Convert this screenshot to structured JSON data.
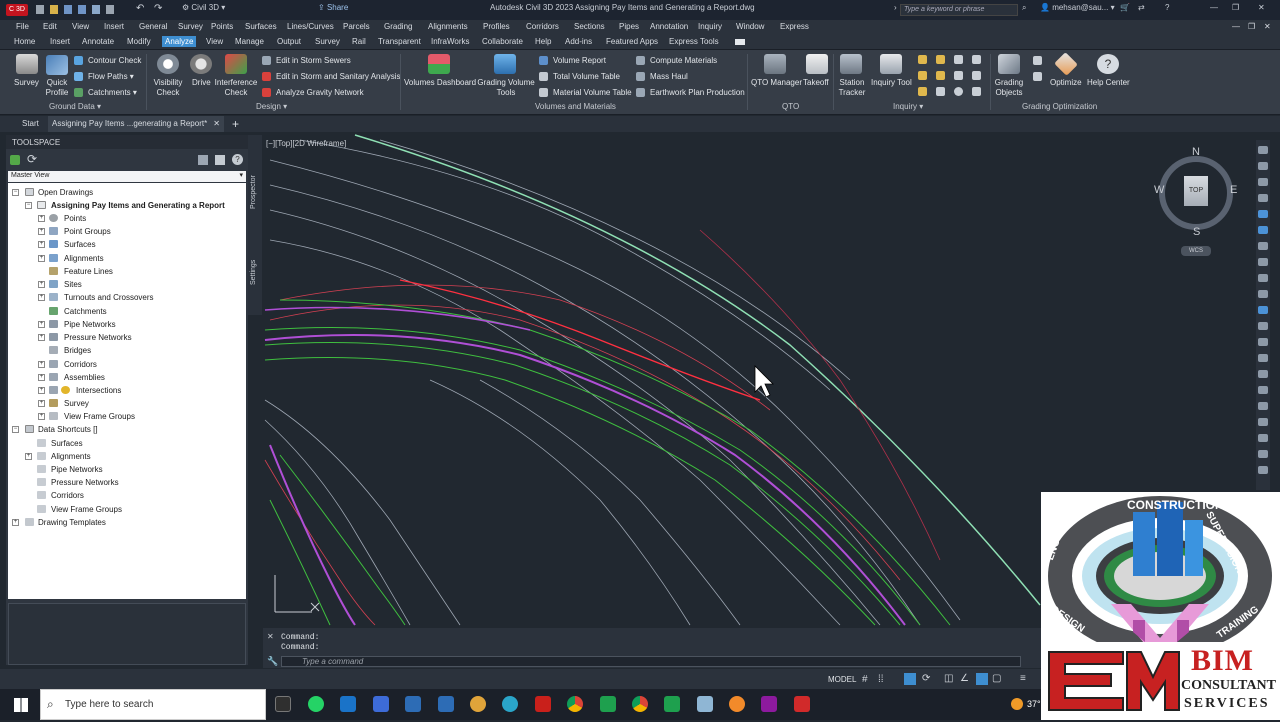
{
  "titlebar": {
    "app_badge": "C 3D",
    "workspace": "Civil 3D",
    "share": "Share",
    "title": "Autodesk Civil 3D 2023    Assigning Pay Items and Generating a Report.dwg",
    "search_placeholder": "Type a keyword or phrase",
    "user": "mehsan@sau..."
  },
  "menu": [
    "File",
    "Edit",
    "View",
    "Insert",
    "General",
    "Survey",
    "Points",
    "Surfaces",
    "Lines/Curves",
    "Parcels",
    "Grading",
    "Alignments",
    "Profiles",
    "Corridors",
    "Sections",
    "Pipes",
    "Annotation",
    "Inquiry",
    "Window",
    "Express"
  ],
  "ribbon_tabs": [
    "Home",
    "Insert",
    "Annotate",
    "Modify",
    "Analyze",
    "View",
    "Manage",
    "Output",
    "Survey",
    "Rail",
    "Transparent",
    "InfraWorks",
    "Collaborate",
    "Help",
    "Add-ins",
    "Featured Apps",
    "Express Tools"
  ],
  "ribbon": {
    "ground_data": {
      "survey": "Survey",
      "quick_profile": [
        "Quick",
        "Profile"
      ],
      "contour_check": "Contour Check",
      "flow_paths": "Flow Paths",
      "catchments": "Catchments",
      "group": "Ground Data"
    },
    "design": {
      "visibility_check": [
        "Visibility",
        "Check"
      ],
      "drive": "Drive",
      "interference_check": [
        "Interference",
        "Check"
      ],
      "edit_storm": "Edit in Storm Sewers",
      "edit_storm_sanitary": "Edit in Storm and Sanitary Analysis",
      "analyze_gravity": "Analyze Gravity Network",
      "group": "Design"
    },
    "volumes": {
      "volumes_dashboard": "Volumes Dashboard",
      "grading_volume_tools": [
        "Grading Volume",
        "Tools"
      ],
      "volume_report": "Volume Report",
      "total_volume_table": "Total Volume Table",
      "material_volume_table": "Material Volume Table",
      "compute_materials": "Compute Materials",
      "mass_haul": "Mass Haul",
      "earthwork_plan": "Earthwork Plan Production",
      "group": "Volumes and Materials"
    },
    "qto": {
      "qto_manager": "QTO Manager",
      "takeoff": "Takeoff",
      "group": "QTO"
    },
    "inquiry": {
      "station_tracker": [
        "Station",
        "Tracker"
      ],
      "inquiry_tool": "Inquiry Tool",
      "group": "Inquiry"
    },
    "grading_opt": {
      "grading_objects": [
        "Grading",
        "Objects"
      ],
      "optimize": "Optimize",
      "help_center": "Help Center",
      "group": "Grading Optimization"
    }
  },
  "doc_tabs": {
    "start": "Start",
    "active": "Assigning Pay Items ...generating a Report*"
  },
  "toolspace": {
    "title": "TOOLSPACE",
    "view": "Master View",
    "vertical_tabs": [
      "Prospector",
      "Settings"
    ],
    "tree": {
      "open_drawings": "Open Drawings",
      "drawing": "Assigning Pay Items and Generating a Report",
      "drawing_items": [
        "Points",
        "Point Groups",
        "Surfaces",
        "Alignments",
        "Feature Lines",
        "Sites",
        "Turnouts and Crossovers",
        "Catchments",
        "Pipe Networks",
        "Pressure Networks",
        "Bridges",
        "Corridors",
        "Assemblies",
        "Intersections",
        "Survey",
        "View Frame Groups"
      ],
      "data_shortcuts": "Data Shortcuts []",
      "shortcut_items": [
        "Surfaces",
        "Alignments",
        "Pipe Networks",
        "Pressure Networks",
        "Corridors",
        "View Frame Groups"
      ],
      "drawing_templates": "Drawing Templates"
    }
  },
  "viewport_label": "[−][Top][2D Wireframe]",
  "viewcube": {
    "n": "N",
    "s": "S",
    "e": "E",
    "w": "W",
    "top": "TOP",
    "wcs": "WCS"
  },
  "command": {
    "line1": "Command:",
    "line2": "Command:",
    "placeholder": "Type a command"
  },
  "status": {
    "model": "MODEL"
  },
  "taskbar": {
    "search": "Type here to search",
    "temp": "37°"
  },
  "logo": {
    "ring_top": "CONSTRUCTION",
    "ring_left": "ENGINEERING",
    "ring_right": "SUPERVISION",
    "ring_bottom_left": "DESIGN",
    "ring_bottom_right": "TRAINING",
    "letters": "EM",
    "word1": "BIM",
    "word2": "CONSULTANT",
    "word3": "SERVICES"
  }
}
